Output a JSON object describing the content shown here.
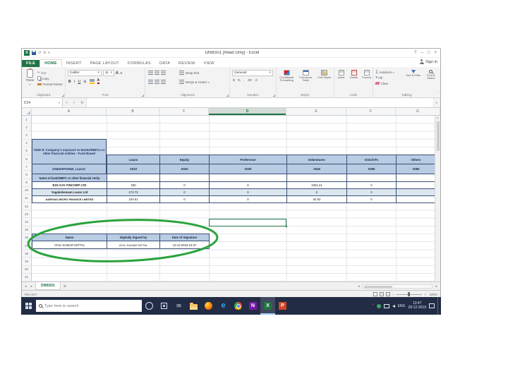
{
  "titlebar": {
    "title": "DNBS01  [Read Only] - Excel",
    "help": "?",
    "minimize": "–",
    "restore": "□",
    "close": "×"
  },
  "quick_access": {
    "logo": "X",
    "undo": "↺",
    "redo": "↻",
    "dropdown": "▾"
  },
  "account": {
    "sign_in": "Sign in"
  },
  "tabs": {
    "file": "FILE",
    "home": "HOME",
    "insert": "INSERT",
    "page_layout": "PAGE LAYOUT",
    "formulas": "FORMULAS",
    "data": "DATA",
    "review": "REVIEW",
    "view": "VIEW"
  },
  "ribbon": {
    "clipboard": {
      "paste": "Paste",
      "cut": "Cut",
      "copy": "Copy",
      "format_painter": "Format Painter",
      "label": "Clipboard"
    },
    "font": {
      "family": "Calibri",
      "size": "11",
      "bold": "B",
      "italic": "I",
      "underline": "U",
      "grow": "A",
      "shrink": "A",
      "font_color": "A",
      "label": "Font"
    },
    "alignment": {
      "wrap_text": "Wrap Text",
      "merge_center": "Merge & Center",
      "label": "Alignment"
    },
    "number": {
      "format": "General",
      "currency": "$",
      "percent": "%",
      "comma": ",",
      "inc_dec": ".00",
      "dec_dec": ".0",
      "label": "Number"
    },
    "styles": {
      "conditional": "Conditional Formatting",
      "format_table": "Format as Table",
      "cell_styles": "Cell Styles",
      "label": "Styles"
    },
    "cells": {
      "insert": "Insert",
      "delete": "Delete",
      "format": "Format",
      "label": "Cells"
    },
    "editing": {
      "autosum": "AutoSum",
      "fill": "Fill",
      "clear": "Clear",
      "sort_filter": "Sort & Filter",
      "find_select": "Find & Select",
      "label": "Editing"
    }
  },
  "formula_bar": {
    "name_box": "D14",
    "cancel": "×",
    "enter": "✓",
    "fx": "fx"
  },
  "grid": {
    "columns": [
      "A",
      "B",
      "C",
      "D",
      "E",
      "F",
      "G"
    ],
    "selected_column": "D",
    "rows": [
      "1",
      "2",
      "3",
      "4",
      "5",
      "6",
      "7",
      "8",
      "9",
      "10",
      "11",
      "12",
      "13",
      "14",
      "15",
      "16",
      "17",
      "18",
      "19",
      "20",
      "21"
    ]
  },
  "table8": {
    "title": "Table 8: Company's exposure to Banks/NBFCs or other financial entities - Fund Based",
    "layout_label": "DNBSHPARI4B_Layout:",
    "headers": [
      "Loans",
      "Equity",
      "Preference",
      "Debentures",
      "ICDs/CPs",
      "Others"
    ],
    "codes": [
      "X010",
      "X020",
      "X030",
      "X040",
      "X050",
      "X060"
    ],
    "section": "Name of bank/NBFC or other financial entity",
    "rows": [
      {
        "name": "ESS KAY FINCORP LTD",
        "values": [
          "250",
          "0",
          "0",
          "3461.21",
          "0",
          ""
        ]
      },
      {
        "name": "Yogakshemam Loans Ltd",
        "values": [
          "272.73",
          "0",
          "0",
          "0",
          "0",
          ""
        ]
      },
      {
        "name": "ASIRVAD MICRO FINANCE LIMITED",
        "values": [
          "104.61",
          "0",
          "0",
          "62.52",
          "0",
          ""
        ]
      }
    ]
  },
  "signature": {
    "headers": [
      "Name",
      "Digitally Signed by",
      "Date of Signature"
    ],
    "row": [
      "ATUL KUMAR MITTAL",
      "ATUL KUMAR MITTAL",
      "13-11-2018 10:37"
    ]
  },
  "annotation": {
    "ellipse_color": "#2aa33c"
  },
  "sheet_tabs": {
    "nav_left": "◂",
    "nav_right": "▸",
    "active": "DNBS01",
    "add": "⊕"
  },
  "status_bar": {
    "mode": "READY",
    "zoom_out": "−",
    "zoom_in": "+",
    "zoom": "100%"
  },
  "taskbar": {
    "search_placeholder": "Type here to search",
    "language": "ENG",
    "time": "13:47",
    "date": "28-12-2019",
    "edge": "e",
    "onenote": "N",
    "excel": "X",
    "powerpoint": "P",
    "app_icons": [
      "start",
      "search",
      "cortana",
      "task-view",
      "mail",
      "file-explorer",
      "firefox",
      "edge",
      "chrome",
      "onenote",
      "excel",
      "powerpoint"
    ]
  },
  "glyphs": {
    "cut": "✂",
    "borders": "⊞",
    "autosum": "∑",
    "mail": "✉",
    "scroll_up": "▴",
    "scroll_left": "◂",
    "scroll_right": "▸",
    "collapse": "ˆ",
    "tray_expand": "ˆ",
    "fill_arrow": "▾",
    "dropdown": "▾"
  }
}
